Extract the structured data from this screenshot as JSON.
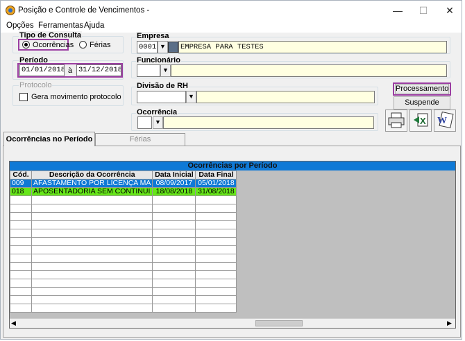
{
  "window": {
    "title": "Posição e Controle de Vencimentos -",
    "min": "—",
    "max": "☐",
    "close": "✕"
  },
  "menu": [
    "Opções",
    "Ferramentas",
    "Ajuda"
  ],
  "tipo_consulta": {
    "label": "Tipo de Consulta",
    "opt1": "Ocorrências",
    "opt2": "Férias",
    "selected": "Ocorrências"
  },
  "periodo": {
    "label": "Período",
    "start": "01/01/2018",
    "sep": "à",
    "end": "31/12/2018"
  },
  "protocolo": {
    "label": "Protocolo",
    "check": "Gera movimento protocolo"
  },
  "empresa": {
    "label": "Empresa",
    "code": "0001",
    "name": "EMPRESA PARA TESTES"
  },
  "funcionario": {
    "label": "Funcionário",
    "code": "",
    "name": ""
  },
  "divisao": {
    "label": "Divisão de RH",
    "code": "",
    "name": ""
  },
  "ocorrencia": {
    "label": "Ocorrência",
    "code": "",
    "name": ""
  },
  "buttons": {
    "processamento": "Processamento",
    "suspende": "Suspende"
  },
  "tools": {
    "print": "printer-icon",
    "excel": "excel-icon",
    "word": "word-icon"
  },
  "tabs": [
    "Ocorrências no Período",
    "Férias"
  ],
  "grid": {
    "title": "Ocorrências por Período",
    "columns": [
      "Cód.",
      "Descrição da Ocorrência",
      "Data Inicial",
      "Data Final"
    ],
    "rows": [
      [
        "009",
        "AFASTAMENTO POR LICENÇA MA",
        "08/09/2017",
        "05/01/2018"
      ],
      [
        "018",
        "APOSENTADORIA SEM CONTINUI",
        "18/08/2018",
        "31/08/2018"
      ]
    ],
    "row_colors": [
      "#0f79d6",
      "#66e619"
    ]
  },
  "colors": {
    "highlight": "#9b3ea2",
    "grid_header": "#0f79d6"
  }
}
